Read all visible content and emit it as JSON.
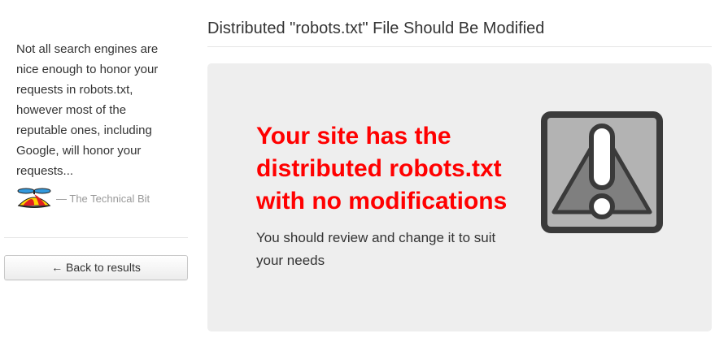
{
  "sidebar": {
    "quote": "Not all search engines are nice enough to honor your requests in robots.txt, however most of the reputable ones, including Google, will honor your requests...",
    "attribution": "— The Technical Bit",
    "attribution_icon": "propeller-beanie-icon",
    "back_button_label": "← Back to results"
  },
  "main": {
    "title": "Distributed \"robots.txt\" File Should Be Modified",
    "headline": "Your site has the distributed robots.txt with no modifications",
    "subtext": "You should review and change it to suit your needs",
    "icon": "warning-icon"
  },
  "colors": {
    "headline": "#ff0000",
    "panel_background": "#eeeeee",
    "icon_frame": "#3a3a3a",
    "icon_fill": "#b3b3b3",
    "icon_triangle": "#7f7f7f"
  }
}
